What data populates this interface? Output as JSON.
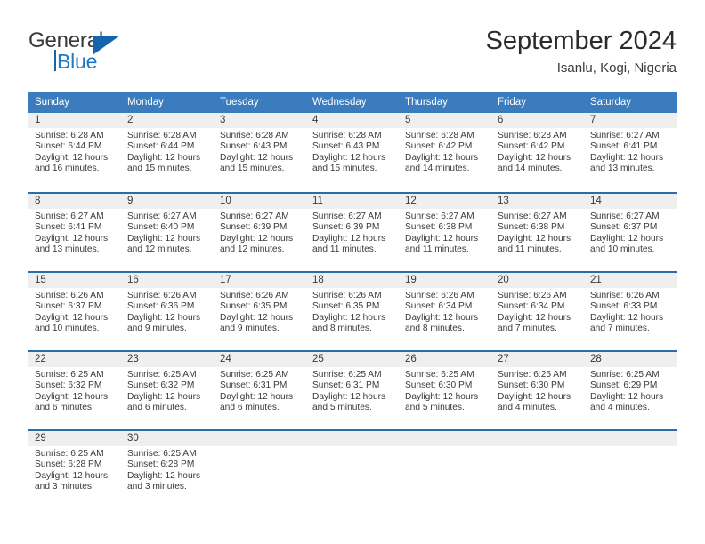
{
  "brand": {
    "name_part1": "General",
    "name_part2": "Blue",
    "logo_icon": "triangle-flag-icon"
  },
  "header": {
    "title": "September 2024",
    "location": "Isanlu, Kogi, Nigeria"
  },
  "weekday_headers": [
    "Sunday",
    "Monday",
    "Tuesday",
    "Wednesday",
    "Thursday",
    "Friday",
    "Saturday"
  ],
  "colors": {
    "header_blue": "#3a7cbe",
    "row_border_blue": "#2b6cac",
    "daynum_band": "#efefef",
    "brand_blue": "#1565ae",
    "text": "#3a3a3a"
  },
  "labels": {
    "sunrise_prefix": "Sunrise:",
    "sunset_prefix": "Sunset:",
    "daylight_prefix": "Daylight:"
  },
  "weeks": [
    {
      "days": [
        {
          "day": "1",
          "sunrise": "Sunrise: 6:28 AM",
          "sunset": "Sunset: 6:44 PM",
          "daylight_line1": "Daylight: 12 hours",
          "daylight_line2": "and 16 minutes."
        },
        {
          "day": "2",
          "sunrise": "Sunrise: 6:28 AM",
          "sunset": "Sunset: 6:44 PM",
          "daylight_line1": "Daylight: 12 hours",
          "daylight_line2": "and 15 minutes."
        },
        {
          "day": "3",
          "sunrise": "Sunrise: 6:28 AM",
          "sunset": "Sunset: 6:43 PM",
          "daylight_line1": "Daylight: 12 hours",
          "daylight_line2": "and 15 minutes."
        },
        {
          "day": "4",
          "sunrise": "Sunrise: 6:28 AM",
          "sunset": "Sunset: 6:43 PM",
          "daylight_line1": "Daylight: 12 hours",
          "daylight_line2": "and 15 minutes."
        },
        {
          "day": "5",
          "sunrise": "Sunrise: 6:28 AM",
          "sunset": "Sunset: 6:42 PM",
          "daylight_line1": "Daylight: 12 hours",
          "daylight_line2": "and 14 minutes."
        },
        {
          "day": "6",
          "sunrise": "Sunrise: 6:28 AM",
          "sunset": "Sunset: 6:42 PM",
          "daylight_line1": "Daylight: 12 hours",
          "daylight_line2": "and 14 minutes."
        },
        {
          "day": "7",
          "sunrise": "Sunrise: 6:27 AM",
          "sunset": "Sunset: 6:41 PM",
          "daylight_line1": "Daylight: 12 hours",
          "daylight_line2": "and 13 minutes."
        }
      ]
    },
    {
      "days": [
        {
          "day": "8",
          "sunrise": "Sunrise: 6:27 AM",
          "sunset": "Sunset: 6:41 PM",
          "daylight_line1": "Daylight: 12 hours",
          "daylight_line2": "and 13 minutes."
        },
        {
          "day": "9",
          "sunrise": "Sunrise: 6:27 AM",
          "sunset": "Sunset: 6:40 PM",
          "daylight_line1": "Daylight: 12 hours",
          "daylight_line2": "and 12 minutes."
        },
        {
          "day": "10",
          "sunrise": "Sunrise: 6:27 AM",
          "sunset": "Sunset: 6:39 PM",
          "daylight_line1": "Daylight: 12 hours",
          "daylight_line2": "and 12 minutes."
        },
        {
          "day": "11",
          "sunrise": "Sunrise: 6:27 AM",
          "sunset": "Sunset: 6:39 PM",
          "daylight_line1": "Daylight: 12 hours",
          "daylight_line2": "and 11 minutes."
        },
        {
          "day": "12",
          "sunrise": "Sunrise: 6:27 AM",
          "sunset": "Sunset: 6:38 PM",
          "daylight_line1": "Daylight: 12 hours",
          "daylight_line2": "and 11 minutes."
        },
        {
          "day": "13",
          "sunrise": "Sunrise: 6:27 AM",
          "sunset": "Sunset: 6:38 PM",
          "daylight_line1": "Daylight: 12 hours",
          "daylight_line2": "and 11 minutes."
        },
        {
          "day": "14",
          "sunrise": "Sunrise: 6:27 AM",
          "sunset": "Sunset: 6:37 PM",
          "daylight_line1": "Daylight: 12 hours",
          "daylight_line2": "and 10 minutes."
        }
      ]
    },
    {
      "days": [
        {
          "day": "15",
          "sunrise": "Sunrise: 6:26 AM",
          "sunset": "Sunset: 6:37 PM",
          "daylight_line1": "Daylight: 12 hours",
          "daylight_line2": "and 10 minutes."
        },
        {
          "day": "16",
          "sunrise": "Sunrise: 6:26 AM",
          "sunset": "Sunset: 6:36 PM",
          "daylight_line1": "Daylight: 12 hours",
          "daylight_line2": "and 9 minutes."
        },
        {
          "day": "17",
          "sunrise": "Sunrise: 6:26 AM",
          "sunset": "Sunset: 6:35 PM",
          "daylight_line1": "Daylight: 12 hours",
          "daylight_line2": "and 9 minutes."
        },
        {
          "day": "18",
          "sunrise": "Sunrise: 6:26 AM",
          "sunset": "Sunset: 6:35 PM",
          "daylight_line1": "Daylight: 12 hours",
          "daylight_line2": "and 8 minutes."
        },
        {
          "day": "19",
          "sunrise": "Sunrise: 6:26 AM",
          "sunset": "Sunset: 6:34 PM",
          "daylight_line1": "Daylight: 12 hours",
          "daylight_line2": "and 8 minutes."
        },
        {
          "day": "20",
          "sunrise": "Sunrise: 6:26 AM",
          "sunset": "Sunset: 6:34 PM",
          "daylight_line1": "Daylight: 12 hours",
          "daylight_line2": "and 7 minutes."
        },
        {
          "day": "21",
          "sunrise": "Sunrise: 6:26 AM",
          "sunset": "Sunset: 6:33 PM",
          "daylight_line1": "Daylight: 12 hours",
          "daylight_line2": "and 7 minutes."
        }
      ]
    },
    {
      "days": [
        {
          "day": "22",
          "sunrise": "Sunrise: 6:25 AM",
          "sunset": "Sunset: 6:32 PM",
          "daylight_line1": "Daylight: 12 hours",
          "daylight_line2": "and 6 minutes."
        },
        {
          "day": "23",
          "sunrise": "Sunrise: 6:25 AM",
          "sunset": "Sunset: 6:32 PM",
          "daylight_line1": "Daylight: 12 hours",
          "daylight_line2": "and 6 minutes."
        },
        {
          "day": "24",
          "sunrise": "Sunrise: 6:25 AM",
          "sunset": "Sunset: 6:31 PM",
          "daylight_line1": "Daylight: 12 hours",
          "daylight_line2": "and 6 minutes."
        },
        {
          "day": "25",
          "sunrise": "Sunrise: 6:25 AM",
          "sunset": "Sunset: 6:31 PM",
          "daylight_line1": "Daylight: 12 hours",
          "daylight_line2": "and 5 minutes."
        },
        {
          "day": "26",
          "sunrise": "Sunrise: 6:25 AM",
          "sunset": "Sunset: 6:30 PM",
          "daylight_line1": "Daylight: 12 hours",
          "daylight_line2": "and 5 minutes."
        },
        {
          "day": "27",
          "sunrise": "Sunrise: 6:25 AM",
          "sunset": "Sunset: 6:30 PM",
          "daylight_line1": "Daylight: 12 hours",
          "daylight_line2": "and 4 minutes."
        },
        {
          "day": "28",
          "sunrise": "Sunrise: 6:25 AM",
          "sunset": "Sunset: 6:29 PM",
          "daylight_line1": "Daylight: 12 hours",
          "daylight_line2": "and 4 minutes."
        }
      ]
    },
    {
      "days": [
        {
          "day": "29",
          "sunrise": "Sunrise: 6:25 AM",
          "sunset": "Sunset: 6:28 PM",
          "daylight_line1": "Daylight: 12 hours",
          "daylight_line2": "and 3 minutes."
        },
        {
          "day": "30",
          "sunrise": "Sunrise: 6:25 AM",
          "sunset": "Sunset: 6:28 PM",
          "daylight_line1": "Daylight: 12 hours",
          "daylight_line2": "and 3 minutes."
        },
        {
          "day": "",
          "sunrise": "",
          "sunset": "",
          "daylight_line1": "",
          "daylight_line2": ""
        },
        {
          "day": "",
          "sunrise": "",
          "sunset": "",
          "daylight_line1": "",
          "daylight_line2": ""
        },
        {
          "day": "",
          "sunrise": "",
          "sunset": "",
          "daylight_line1": "",
          "daylight_line2": ""
        },
        {
          "day": "",
          "sunrise": "",
          "sunset": "",
          "daylight_line1": "",
          "daylight_line2": ""
        },
        {
          "day": "",
          "sunrise": "",
          "sunset": "",
          "daylight_line1": "",
          "daylight_line2": ""
        }
      ]
    }
  ]
}
